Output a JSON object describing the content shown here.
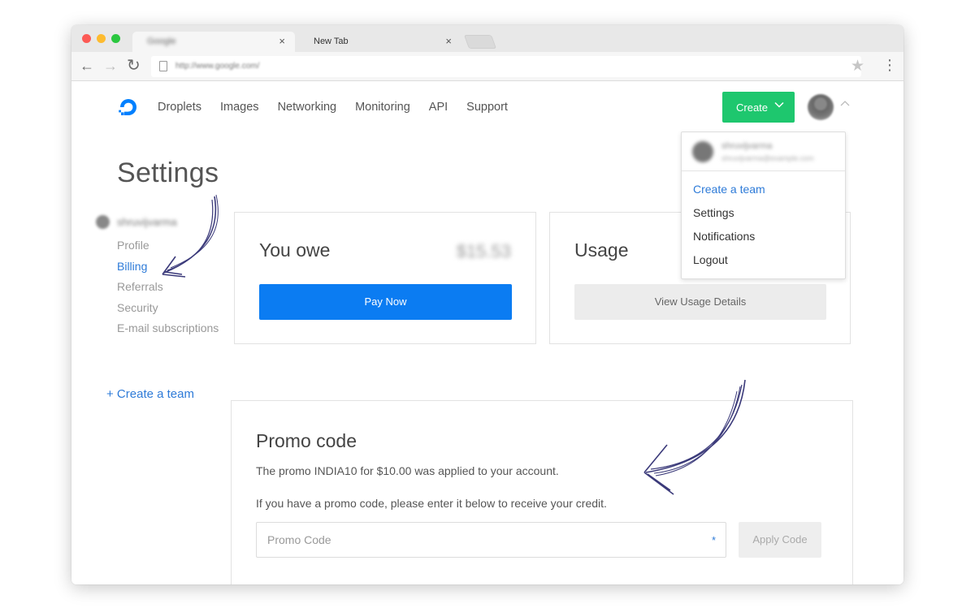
{
  "browser": {
    "tabs": [
      {
        "title": "Google",
        "close": "×"
      },
      {
        "title": "New Tab",
        "close": "×"
      }
    ],
    "url": "http://www.google.com/",
    "icons": {
      "back": "arrow-left-icon",
      "forward": "arrow-right-icon",
      "reload": "reload-icon",
      "star": "star-icon",
      "menu": "kebab-menu-icon"
    }
  },
  "header": {
    "nav": [
      "Droplets",
      "Images",
      "Networking",
      "Monitoring",
      "API",
      "Support"
    ],
    "create_label": "Create",
    "brand_color": "#0080ff",
    "create_color": "#1ec76e"
  },
  "dropdown": {
    "username": "shruvijvarma",
    "email": "shruvijvarma@example.com",
    "items": [
      "Create a team",
      "Settings",
      "Notifications",
      "Logout"
    ]
  },
  "settings": {
    "title": "Settings",
    "username": "shruvijvarma",
    "menu": [
      "Profile",
      "Billing",
      "Referrals",
      "Security",
      "E-mail subscriptions"
    ],
    "active_item": "Billing",
    "create_team": "+ Create a team"
  },
  "billing": {
    "owe_title": "You owe",
    "owe_amount": "$15.53",
    "pay_button": "Pay Now",
    "usage_title": "Usage",
    "usage_button": "View Usage Details"
  },
  "promo": {
    "title": "Promo code",
    "applied_text": "The promo INDIA10 for $10.00 was applied to your account.",
    "help_text": "If you have a promo code, please enter it below to receive your credit.",
    "input_placeholder": "Promo Code",
    "required_mark": "*",
    "apply_button": "Apply Code"
  }
}
